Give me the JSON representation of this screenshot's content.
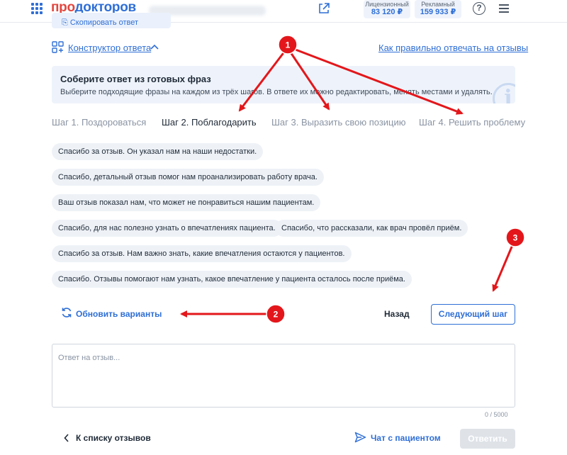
{
  "header": {
    "logo_part1": "про",
    "logo_part2": "докторов",
    "balances": [
      {
        "label": "Лицензионный",
        "value": "83 120 ₽"
      },
      {
        "label": "Рекламный",
        "value": "159 933 ₽"
      }
    ],
    "help_label": "?"
  },
  "constructor": {
    "link_label": "Конструктор ответа",
    "howto_label": "Как правильно отвечать на отзывы"
  },
  "info": {
    "title": "Соберите ответ из готовых фраз",
    "text": "Выберите подходящие фразы на каждом из трёх шагов. В ответе их можно редактировать, менять местами и удалять."
  },
  "steps": [
    "Шаг 1. Поздороваться",
    "Шаг 2. Поблагодарить",
    "Шаг 3. Выразить свою позицию",
    "Шаг 4. Решить проблему"
  ],
  "phrases": [
    "Спасибо за отзыв. Он указал нам на наши недостатки.",
    "Спасибо, детальный отзыв помог нам проанализировать работу врача.",
    "Ваш отзыв показал нам, что может не понравиться нашим пациентам.",
    "Спасибо, для нас полезно узнать о впечатлениях пациента.",
    "Спасибо, что рассказали, как врач провёл приём.",
    "Спасибо за отзыв. Нам важно знать, какие впечатления остаются у пациентов.",
    "Спасибо. Отзывы помогают нам узнать, какое впечатление у пациента осталось после приёма."
  ],
  "actions": {
    "refresh_label": "Обновить варианты",
    "back_label": "Назад",
    "next_label": "Следующий шаг"
  },
  "answer": {
    "placeholder": "Ответ на отзыв...",
    "counter": "0 / 5000"
  },
  "footer": {
    "back_to_list": "К списку отзывов",
    "chat_label": "Чат с пациентом",
    "reply_label": "Ответить"
  },
  "annotations": [
    "1",
    "2",
    "3"
  ],
  "colors": {
    "accent": "#2f6fd6",
    "logo_red": "#e2463f",
    "annotation_red": "#e3171b"
  }
}
